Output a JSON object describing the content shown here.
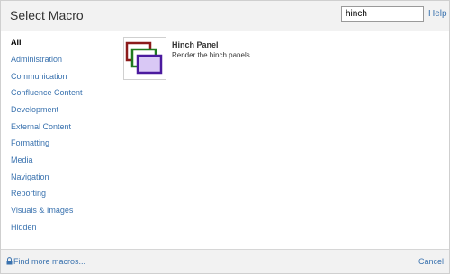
{
  "dialog": {
    "title": "Select Macro",
    "search": {
      "value": "hinch",
      "placeholder": ""
    },
    "help_label": "Help"
  },
  "sidebar": {
    "items": [
      {
        "label": "All"
      },
      {
        "label": "Administration"
      },
      {
        "label": "Communication"
      },
      {
        "label": "Confluence Content"
      },
      {
        "label": "Development"
      },
      {
        "label": "External Content"
      },
      {
        "label": "Formatting"
      },
      {
        "label": "Media"
      },
      {
        "label": "Navigation"
      },
      {
        "label": "Reporting"
      },
      {
        "label": "Visuals & Images"
      },
      {
        "label": "Hidden"
      }
    ]
  },
  "results": [
    {
      "name": "Hinch Panel",
      "description": "Render the hinch panels",
      "icon": "stacked-panels-icon"
    }
  ],
  "footer": {
    "find_more_label": "Find more macros...",
    "cancel_label": "Cancel",
    "find_more_icon": "lock-icon"
  },
  "colors": {
    "link": "#3b73af",
    "panel_red": "#8b1a1a",
    "panel_green": "#1f7a1f",
    "panel_purple": "#4b1a9e"
  }
}
